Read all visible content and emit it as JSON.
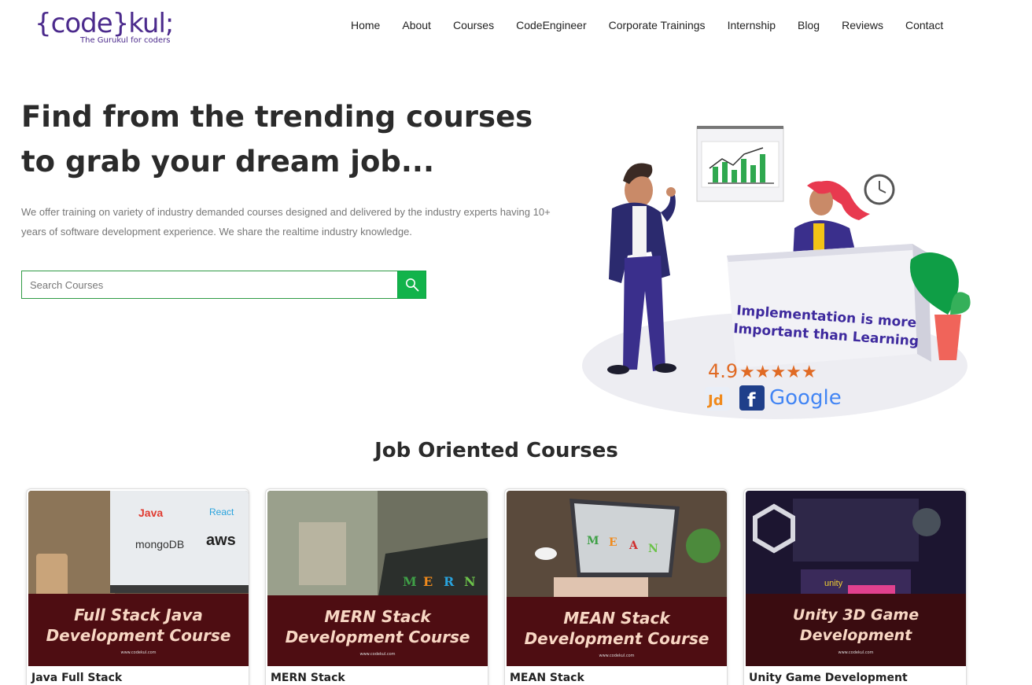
{
  "brand": {
    "logo_text": "{code}kul;",
    "tagline": "The Gurukul for coders"
  },
  "nav": {
    "items": [
      "Home",
      "About",
      "Courses",
      "CodeEngineer",
      "Corporate Trainings",
      "Internship",
      "Blog",
      "Reviews",
      "Contact"
    ]
  },
  "hero": {
    "title": "Find from the trending courses to grab your dream job...",
    "subtitle": "We offer training on variety of industry demanded courses designed and delivered by the industry experts having 10+ years of software development experience. We share the realtime industry knowledge.",
    "search_placeholder": "Search Courses",
    "illustration": {
      "tagline_line1": "Implementation is more",
      "tagline_line2": "Important than Learning",
      "rating": "4.9",
      "stars": "★★★★★",
      "review_sites": [
        "Jd",
        "f",
        "Google"
      ]
    }
  },
  "courses": {
    "heading": "Job Oriented Courses",
    "items": [
      {
        "name": "Java Full Stack",
        "banner_line1": "Full Stack Java",
        "banner_line2": "Development Course",
        "url": "www.codekul.com",
        "tech": [
          "Java",
          "React",
          "mongoDB",
          "aws"
        ]
      },
      {
        "name": "MERN Stack",
        "banner_line1": "MERN Stack",
        "banner_line2": "Development Course",
        "url": "www.codekul.com",
        "letters": [
          "M",
          "E",
          "R",
          "N"
        ]
      },
      {
        "name": "MEAN Stack",
        "banner_line1": "MEAN Stack",
        "banner_line2": "Development Course",
        "url": "www.codekul.com",
        "letters": [
          "M",
          "E",
          "A",
          "N"
        ]
      },
      {
        "name": "Unity Game Development",
        "banner_line1": "Unity 3D Game Development",
        "banner_line2": "",
        "url": "www.codekul.com",
        "tech": [
          "unity"
        ]
      }
    ]
  },
  "colors": {
    "accent_green": "#12b34b",
    "brand_purple": "#4b2a8c",
    "banner_maroon": "#4e0d12"
  }
}
